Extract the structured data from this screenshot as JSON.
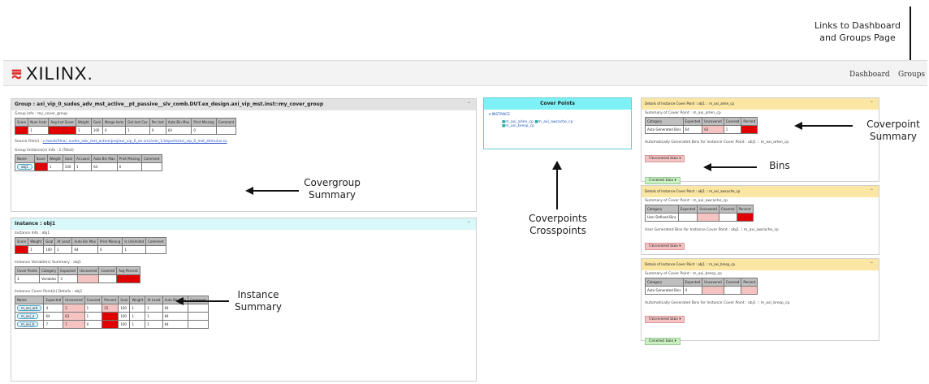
{
  "callouts": {
    "links": "Links to Dashboard and Groups Page",
    "covergroup": "Covergroup Summary",
    "instance": "Instance Summary",
    "coverpoints": "Coverpoints Crosspoints",
    "coverpoint_summary": "Coverpoint Summary",
    "bins": "Bins"
  },
  "header": {
    "logo": "XILINX.",
    "nav": [
      "Dashboard",
      "Groups"
    ]
  },
  "group_panel": {
    "title": "Group : axi_vip_0_sudes_adv_mst_active__pt_passive__slv_comb.DUT.ex_design.axi_vip_mst.inst::my_cover_group",
    "info_label": "Group Info : my_cover_group",
    "info_headers": [
      "Score",
      "Num Insts",
      "Avg Inst Score",
      "Weight",
      "Goal",
      "Merge Insts",
      "Get Inst Cov",
      "Per Inst",
      "Auto Bin Max",
      "Print Missing",
      "Comment"
    ],
    "source_label": "Source File(s) :",
    "source_link": "c:/work/Xlnx/..sudes_adv_mst_active/proj/axi_vip_0_ex.srcs/sim_1/imports/axi_vip_0_mst_stimulus.sv",
    "summary_label": "Group Instance(s) Info : 1 (Total)",
    "summary_headers": [
      "Name",
      "Score",
      "Weight",
      "Goal",
      "At Least",
      "Auto Bin Max",
      "Print Missing",
      "Comment"
    ],
    "summary_row": [
      "obj1",
      "",
      "1",
      "100",
      "1",
      "64",
      "0",
      ""
    ]
  },
  "instance_panel": {
    "title": "Instance : obj1",
    "info_label": "Instance Info : obj1",
    "info_headers": [
      "Score",
      "Weight",
      "Goal",
      "At Least",
      "Auto Bin Max",
      "Print Missing",
      "Is Unlimited",
      "Comment"
    ],
    "info_row": [
      "",
      "1",
      "100",
      "1",
      "64",
      "0",
      "1",
      ""
    ],
    "var_label": "Instance Variable(s) Summary : obj1",
    "var_headers": [
      "Cover Points",
      "Category",
      "Expected",
      "Uncovered",
      "Covered",
      "Avg Percent"
    ],
    "var_row": [
      "3",
      "Variables",
      "3",
      "",
      "",
      ""
    ],
    "cp_label": "Instance Cover Point(s) Details : obj1",
    "cp_headers": [
      "Name",
      "Expected",
      "Uncovered",
      "Covered",
      "Percent",
      "Goal",
      "Weight",
      "At Least",
      "Auto Bin Max",
      "Comment"
    ],
    "cp_rows": [
      {
        "name": "m_axi_arb",
        "expected": "4",
        "uncovered": "3",
        "covered": "1",
        "percent": "25",
        "goal": "100",
        "weight": "1",
        "at_least": "1",
        "auto": "64"
      },
      {
        "name": "m_axi_a",
        "expected": "64",
        "uncovered": "63",
        "covered": "1",
        "percent": "",
        "goal": "100",
        "weight": "1",
        "at_least": "1",
        "auto": "64"
      },
      {
        "name": "m_axi_b",
        "expected": "7",
        "uncovered": "7",
        "covered": "0",
        "percent": "",
        "goal": "100",
        "weight": "1",
        "at_least": "1",
        "auto": "64"
      }
    ]
  },
  "cover_points": {
    "title": "Cover Points",
    "tree_root": "INSTANCE",
    "items": [
      "m_axi_arlen_cp",
      "m_axi_awcache_cp",
      "m_axi_bresp_cp"
    ]
  },
  "details": [
    {
      "title": "Details of Instance Cover Point : obj1 :: m_axi_arlen_cp",
      "summary_label": "Summary of Cover Point : m_axi_arlen_cp",
      "headers": [
        "Category",
        "Expected",
        "Uncovered",
        "Covered",
        "Percent"
      ],
      "row": [
        "Auto Generated Bins",
        "64",
        "63",
        "1",
        ""
      ],
      "bins_label": "Automatically Generated Bins for Instance Cover Point : obj1 :: m_axi_arlen_cp",
      "uncovered": "Uncovered bins",
      "covered": "Covered bins"
    },
    {
      "title": "Details of Instance Cover Point : obj1 :: m_axi_awcache_cp",
      "summary_label": "Summary of Cover Point : m_axi_awcache_cp",
      "headers": [
        "Category",
        "Expected",
        "Uncovered",
        "Covered",
        "Percent"
      ],
      "row": [
        "User Defined Bins",
        "",
        "",
        "",
        ""
      ],
      "bins_label": "User Generated Bins for Instance Cover Point : obj1 :: m_axi_awcache_cp",
      "uncovered": "Uncovered bins",
      "covered": ""
    },
    {
      "title": "Details of Instance Cover Point : obj1 :: m_axi_bresp_cp",
      "summary_label": "Summary of Cover Point : m_axi_bresp_cp",
      "headers": [
        "Category",
        "Expected",
        "Uncovered",
        "Covered",
        "Percent"
      ],
      "row": [
        "Auto Generated Bins",
        "4",
        "",
        "",
        ""
      ],
      "bins_label": "Automatically Generated Bins for Instance Cover Point : obj1 :: m_axi_bresp_cp",
      "uncovered": "Uncovered bins",
      "covered": "Covered bins"
    }
  ]
}
